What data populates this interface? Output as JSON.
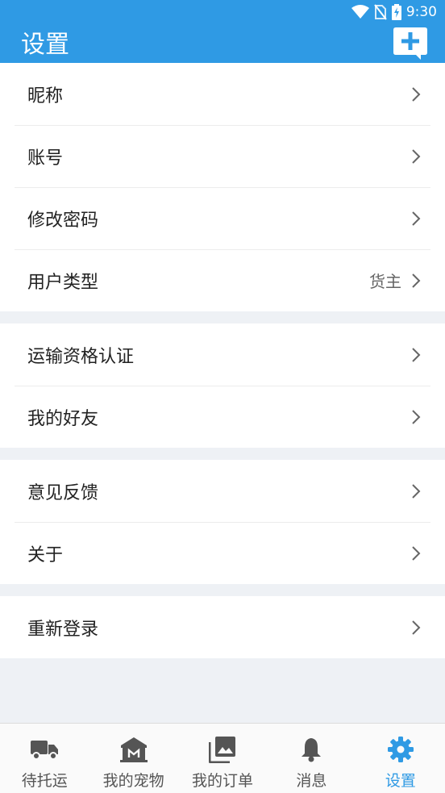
{
  "status_bar": {
    "time": "9:30"
  },
  "header": {
    "title": "设置"
  },
  "sections": [
    {
      "rows": [
        {
          "label": "昵称",
          "value": ""
        },
        {
          "label": "账号",
          "value": ""
        },
        {
          "label": "修改密码",
          "value": ""
        },
        {
          "label": "用户类型",
          "value": "货主"
        }
      ]
    },
    {
      "rows": [
        {
          "label": "运输资格认证",
          "value": ""
        },
        {
          "label": "我的好友",
          "value": ""
        }
      ]
    },
    {
      "rows": [
        {
          "label": "意见反馈",
          "value": ""
        },
        {
          "label": "关于",
          "value": ""
        }
      ]
    },
    {
      "rows": [
        {
          "label": "重新登录",
          "value": ""
        }
      ]
    }
  ],
  "bottom_nav": {
    "active_index": 4,
    "items": [
      {
        "label": "待托运",
        "icon": "truck-icon"
      },
      {
        "label": "我的宠物",
        "icon": "store-icon"
      },
      {
        "label": "我的订单",
        "icon": "photo-library-icon"
      },
      {
        "label": "消息",
        "icon": "bell-icon"
      },
      {
        "label": "设置",
        "icon": "gear-icon"
      }
    ]
  },
  "colors": {
    "header_bg": "#2f9ae4",
    "active_tab": "#2f9ae4",
    "inactive_tab": "#555555",
    "page_bg": "#eef1f5"
  }
}
